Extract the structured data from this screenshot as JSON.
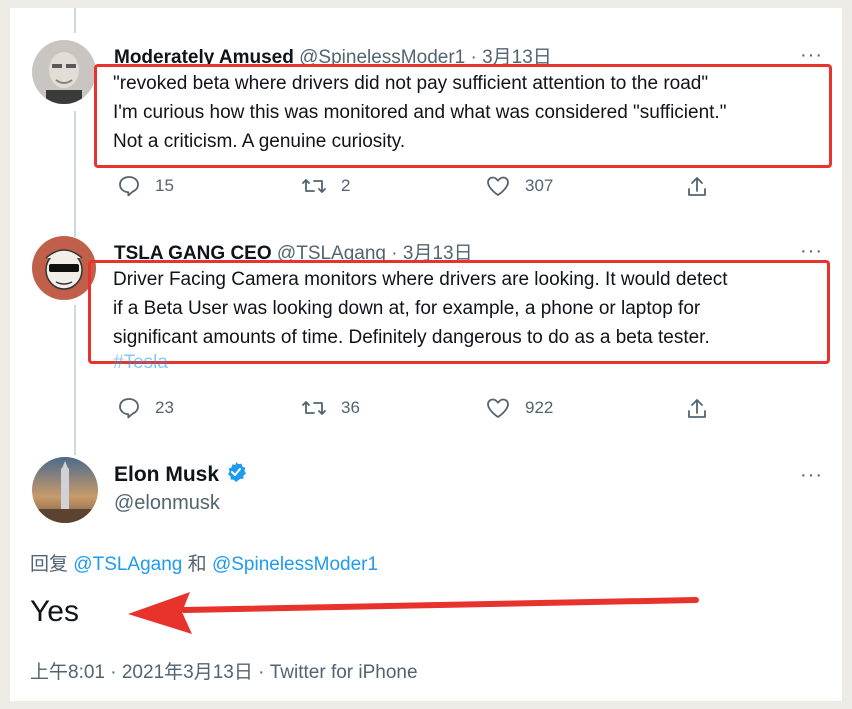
{
  "tweets": [
    {
      "name": "Moderately Amused",
      "handle": "@SpinelessModer1",
      "date": "· 3月13日",
      "lines": [
        "\"revoked beta where drivers did not pay sufficient attention to the road\"",
        "I'm curious how this was monitored and what was considered \"sufficient.\"",
        "Not a criticism.  A genuine curiosity."
      ],
      "replies": "15",
      "retweets": "2",
      "likes": "307"
    },
    {
      "name": "TSLA GANG CEO",
      "handle": "@TSLAgang",
      "date": "· 3月13日",
      "lines": [
        "Driver Facing Camera monitors where drivers are looking. It would detect",
        "if a Beta User was looking down at, for example, a phone or laptop for",
        "significant amounts of time. Definitely dangerous to do as a beta tester."
      ],
      "hashtag": "#Tesla",
      "replies": "23",
      "retweets": "36",
      "likes": "922"
    }
  ],
  "main_tweet": {
    "name": "Elon Musk",
    "handle": "@elonmusk",
    "reply_prefix": "回复",
    "mention1": "@TSLAgang",
    "conj": "和",
    "mention2": "@SpinelessModer1",
    "text": "Yes",
    "meta": "上午8:01 · 2021年3月13日 · Twitter for iPhone"
  },
  "more_glyph": "···",
  "colors": {
    "highlight_red": "#e8322c",
    "link_blue": "#1d9bf0",
    "verified_blue": "#1d9bf0"
  },
  "icons": [
    "reply-icon",
    "retweet-icon",
    "like-icon",
    "share-icon",
    "more-icon",
    "verified-badge-icon"
  ]
}
